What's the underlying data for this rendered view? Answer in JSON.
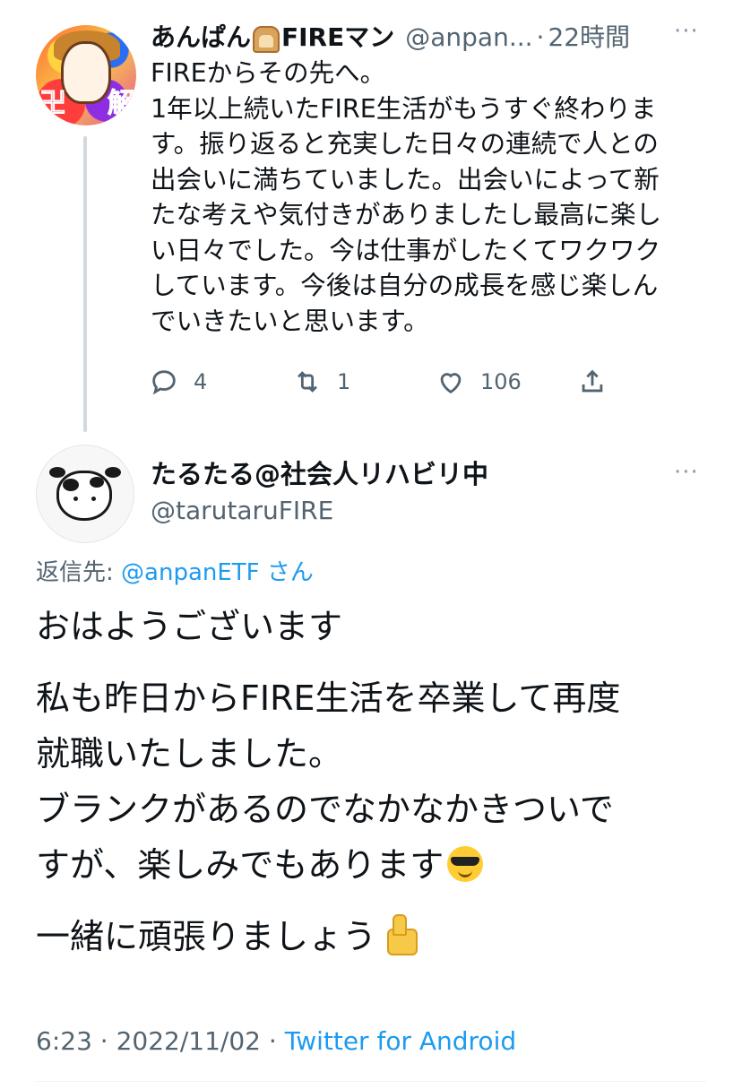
{
  "parent": {
    "name": "あんぱん",
    "name_suffix": "FIREマン",
    "handle": "@anpan...",
    "dot": "·",
    "time": "22時間",
    "more": "···",
    "text_lines": [
      "FIREからその先へ。",
      "1年以上続いたFIRE生活がもうすぐ終わりま",
      "す。振り返ると充実した日々の連続で人との",
      "出会いに満ちていました。出会いによって新",
      "たな考えや気付きがありましたし最高に楽し",
      "い日々でした。今は仕事がしたくてワクワク",
      "しています。今後は自分の成長を感じ楽しん",
      "でいきたいと思います。"
    ],
    "stats": {
      "replies": "4",
      "retweets": "1",
      "likes": "106"
    }
  },
  "reply": {
    "name": "たるたる@社会人リハビリ中",
    "handle": "@tarutaruFIRE",
    "more": "···",
    "replying_label": "返信先:",
    "replying_mention": "@anpanETF",
    "replying_suffix": "さん",
    "lines": {
      "l1": "おはようございます",
      "l2": "私も昨日からFIRE生活を卒業して再度",
      "l3": "就職いたしました。",
      "l4": "ブランクがあるのでなかなかきついで",
      "l5": "すが、楽しみでもあります",
      "l6": "一緒に頑張りましょう"
    },
    "time": "6:23",
    "date": "2022/11/02",
    "sep": "·",
    "source": "Twitter for Android"
  },
  "colors": {
    "accent": "#1d9bf0",
    "secondary_text": "#536471",
    "primary_text": "#0f1419"
  },
  "icons": [
    "reply-icon",
    "retweet-icon",
    "like-icon",
    "share-icon",
    "more-icon",
    "bread-emoji",
    "sunglasses-emoji",
    "thumbs-up-emoji"
  ]
}
